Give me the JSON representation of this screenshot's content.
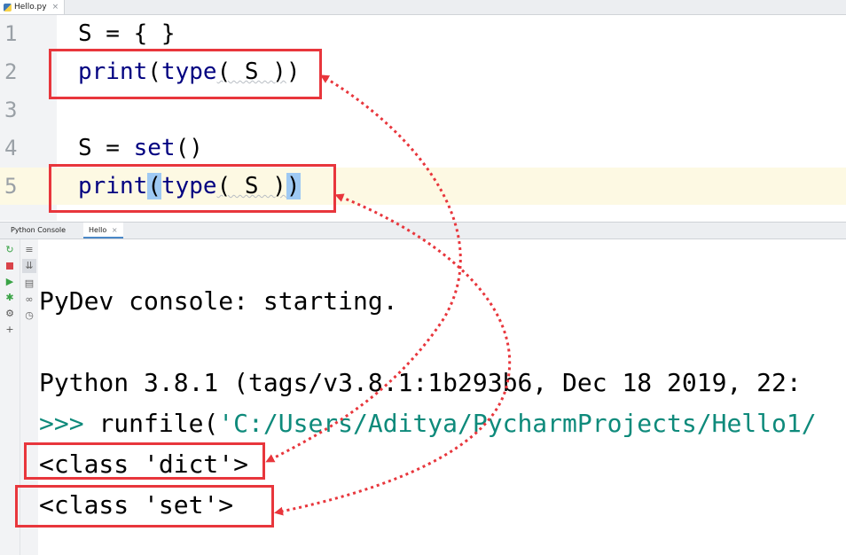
{
  "editor": {
    "tab": {
      "label": "Hello.py",
      "close": "×"
    },
    "lines": [
      {
        "number": "1",
        "text": "S = { }"
      },
      {
        "number": "2",
        "func": "print",
        "open": "(",
        "inner": "type",
        "args": "( S )",
        "close": ")"
      },
      {
        "number": "3",
        "text": ""
      },
      {
        "number": "4",
        "prefix": "S = ",
        "keyword": "set",
        "suffix": "()"
      },
      {
        "number": "5",
        "func": "print",
        "open": "(",
        "inner": "type",
        "args": "( S )",
        "close": ")"
      }
    ]
  },
  "console": {
    "tabs": [
      {
        "label": "Python Console",
        "close": ""
      },
      {
        "label": "Hello",
        "close": "×"
      }
    ],
    "output": {
      "starting": "PyDev console: starting.",
      "version": "Python 3.8.1 (tags/v3.8.1:1b293b6, Dec 18 2019, 22:",
      "prompt": ">>> ",
      "runfile_call": "runfile(",
      "runfile_arg": "'C:/Users/Aditya/PycharmProjects/Hello1/",
      "result_1": "<class 'dict'>",
      "result_2": "<class 'set'>"
    },
    "toolbar_left": [
      "rerun-icon",
      "stop-icon",
      "run-icon",
      "debug-icon",
      "settings-icon",
      "add-icon"
    ],
    "toolbar_right": [
      "soft-wrap-icon",
      "scroll-to-end-icon",
      "print-icon",
      "show-variables-icon",
      "history-icon"
    ]
  },
  "colors": {
    "annotation": "#e8363c",
    "keyword": "#000080",
    "string": "#0e8a7b",
    "current_line": "#fdf9e3",
    "brace_highlight": "#9ec9f3"
  }
}
